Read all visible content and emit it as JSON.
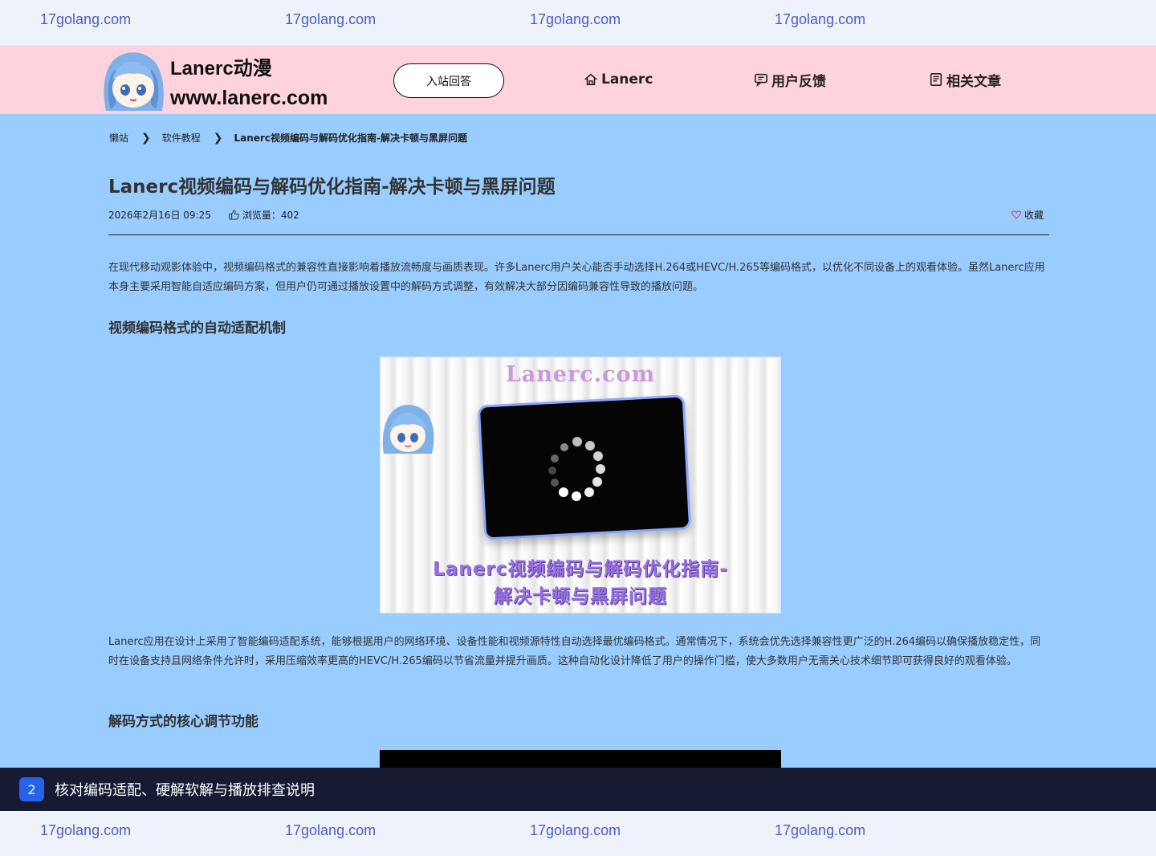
{
  "watermark": {
    "text": "17golang.com"
  },
  "header": {
    "site_name": "Lanerc动漫",
    "site_url": "www.lanerc.com",
    "enter_button": "入站回答",
    "nav": [
      {
        "label": "Lanerc",
        "icon": "home-icon"
      },
      {
        "label": "用户反馈",
        "icon": "chat-icon"
      },
      {
        "label": "相关文章",
        "icon": "document-icon"
      }
    ]
  },
  "breadcrumb": {
    "items": [
      "懒站",
      "软件教程",
      "Lanerc视频编码与解码优化指南-解决卡顿与黑屏问题"
    ]
  },
  "article": {
    "title": "Lanerc视频编码与解码优化指南-解决卡顿与黑屏问题",
    "date": "2026年2月16日 09:25",
    "views_label": "浏览量：402",
    "favorite_label": "收藏",
    "paragraph1": "在现代移动观影体验中，视频编码格式的兼容性直接影响着播放流畅度与画质表现。许多Lanerc用户关心能否手动选择H.264或HEVC/H.265等编码格式，以优化不同设备上的观看体验。虽然Lanerc应用本身主要采用智能自适应编码方案，但用户仍可通过播放设置中的解码方式调整，有效解决大部分因编码兼容性导致的播放问题。",
    "heading1": "视频编码格式的自动适配机制",
    "image": {
      "brand": "Lanerc.com",
      "caption_line1": "Lanerc视频编码与解码优化指南-",
      "caption_line2": "解决卡顿与黑屏问题"
    },
    "paragraph2": "Lanerc应用在设计上采用了智能编码适配系统，能够根据用户的网络环境、设备性能和视频源特性自动选择最优编码格式。通常情况下，系统会优先选择兼容性更广泛的H.264编码以确保播放稳定性，同时在设备支持且网络条件允许时，采用压缩效率更高的HEVC/H.265编码以节省流量并提升画质。这种自动化设计降低了用户的操作门槛，使大多数用户无需关心技术细节即可获得良好的观看体验。",
    "heading2": "解码方式的核心调节功能"
  },
  "footer_banner": {
    "step": "2",
    "text": "核对编码适配、硬解软解与播放排查说明"
  },
  "colors": {
    "background": "#99ccff",
    "header": "#ffd3dd",
    "watermark_bar": "#eef2fb",
    "banner": "#161b33",
    "badge": "#2563eb"
  }
}
